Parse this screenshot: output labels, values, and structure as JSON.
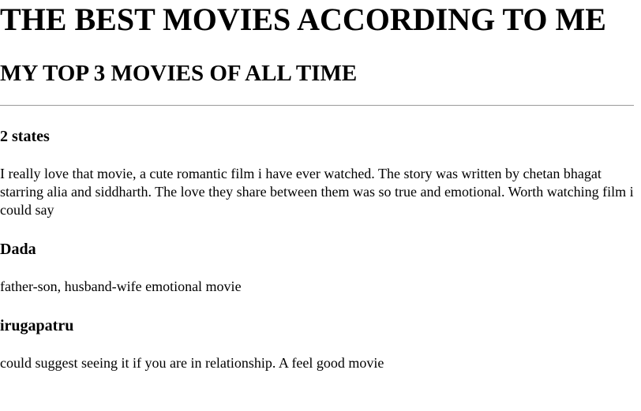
{
  "header": {
    "title": "THE BEST MOVIES ACCORDING TO ME",
    "subtitle": "MY TOP 3 MOVIES OF ALL TIME"
  },
  "movies": [
    {
      "title": "2 states",
      "description": "I really love that movie, a cute romantic film i have ever watched. The story was written by chetan bhagat starring alia and siddharth. The love they share between them was so true and emotional. Worth watching film i could say"
    },
    {
      "title": "Dada",
      "description": "father-son, husband-wife emotional movie"
    },
    {
      "title": "irugapatru",
      "description": "could suggest seeing it if you are in relationship. A feel good movie"
    }
  ]
}
